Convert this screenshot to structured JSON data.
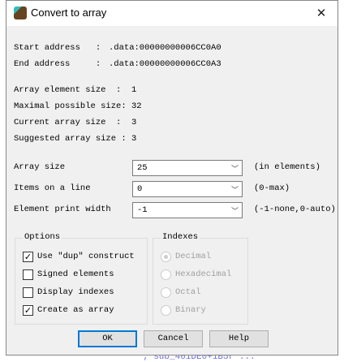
{
  "background_text": "; sub_401DE0+1B5r ...",
  "title": "Convert to array",
  "info": [
    {
      "label": "Start address   :",
      "value": ".data:00000000006CC0A0"
    },
    {
      "label": "End address     :",
      "value": ".data:00000000006CC0A3"
    },
    {
      "label": "Array element size  :",
      "value": "1"
    },
    {
      "label": "Maximal possible size:",
      "value": "32"
    },
    {
      "label": "Current array size  :",
      "value": "3"
    },
    {
      "label": "Suggested array size :",
      "value": "3"
    }
  ],
  "fields": [
    {
      "label": "Array size",
      "value": "25",
      "hint": "(in elements)"
    },
    {
      "label": "Items on a line",
      "value": "0",
      "hint": "(0-max)"
    },
    {
      "label": "Element print width",
      "value": "-1",
      "hint": "(-1-none,0-auto)"
    }
  ],
  "options": {
    "title": "Options",
    "items": [
      {
        "label": "Use \"dup\" construct",
        "checked": true
      },
      {
        "label": "Signed elements",
        "checked": false
      },
      {
        "label": "Display indexes",
        "checked": false
      },
      {
        "label": "Create as array",
        "checked": true
      }
    ]
  },
  "indexes": {
    "title": "Indexes",
    "items": [
      {
        "label": "Decimal",
        "selected": true
      },
      {
        "label": "Hexadecimal",
        "selected": false
      },
      {
        "label": "Octal",
        "selected": false
      },
      {
        "label": "Binary",
        "selected": false
      }
    ]
  },
  "buttons": {
    "ok": "OK",
    "cancel": "Cancel",
    "help": "Help"
  }
}
